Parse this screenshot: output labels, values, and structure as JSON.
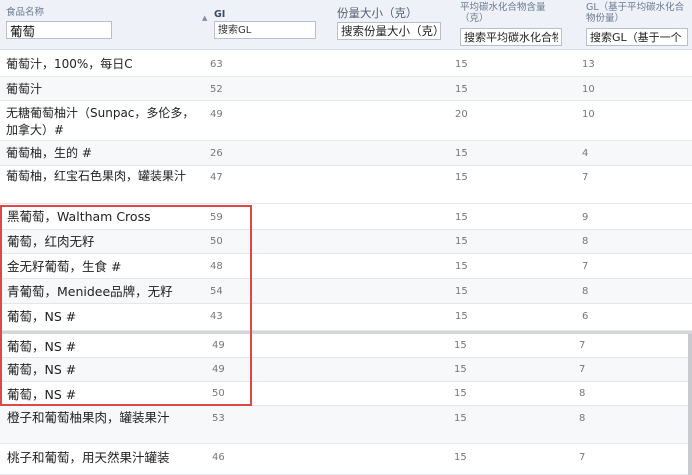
{
  "columns": {
    "name": {
      "label": "食品名称",
      "filter_value": "葡萄"
    },
    "gi": {
      "label": "GI",
      "placeholder": "搜索GL"
    },
    "size": {
      "label": "份量大小（克）",
      "placeholder": "搜索份量大小（克）"
    },
    "carb": {
      "label": "平均碳水化合物含量（克）",
      "placeholder": "搜索平均碳水化合物"
    },
    "gl": {
      "label": "GL（基于平均碳水化合物份量）",
      "placeholder": "搜索GL（基于一个"
    }
  },
  "rows": [
    {
      "name": "葡萄汁，100%，每日C",
      "gi": "63",
      "size": "",
      "carb": "15",
      "gl": "13"
    },
    {
      "name": "葡萄汁",
      "gi": "52",
      "size": "",
      "carb": "15",
      "gl": "10"
    },
    {
      "name": "无糖葡萄柚汁（Sunpac，多伦多，加拿大）#",
      "gi": "49",
      "size": "",
      "carb": "20",
      "gl": "10"
    },
    {
      "name": "葡萄柚，生的 #",
      "gi": "26",
      "size": "",
      "carb": "15",
      "gl": "4"
    },
    {
      "name": "葡萄柚，红宝石色果肉，罐装果汁",
      "gi": "47",
      "size": "",
      "carb": "15",
      "gl": "7"
    },
    {
      "name": "黑葡萄，Waltham Cross",
      "gi": "59",
      "size": "",
      "carb": "15",
      "gl": "9"
    },
    {
      "name": "葡萄，红肉无籽",
      "gi": "50",
      "size": "",
      "carb": "15",
      "gl": "8"
    },
    {
      "name": "金无籽葡萄，生食 #",
      "gi": "48",
      "size": "",
      "carb": "15",
      "gl": "7"
    },
    {
      "name": "青葡萄，Menidee品牌，无籽",
      "gi": "54",
      "size": "",
      "carb": "15",
      "gl": "8"
    },
    {
      "name": "葡萄，NS #",
      "gi": "43",
      "size": "",
      "carb": "15",
      "gl": "6"
    },
    {
      "name": "葡萄，NS #",
      "gi": "49",
      "size": "",
      "carb": "15",
      "gl": "7"
    },
    {
      "name": "葡萄，NS #",
      "gi": "49",
      "size": "",
      "carb": "15",
      "gl": "7"
    },
    {
      "name": "葡萄，NS #",
      "gi": "50",
      "size": "",
      "carb": "15",
      "gl": "8"
    },
    {
      "name": "橙子和葡萄柚果肉，罐装果汁",
      "gi": "53",
      "size": "",
      "carb": "15",
      "gl": "8"
    },
    {
      "name": "桃子和葡萄，用天然果汁罐装",
      "gi": "46",
      "size": "",
      "carb": "15",
      "gl": "7"
    }
  ]
}
